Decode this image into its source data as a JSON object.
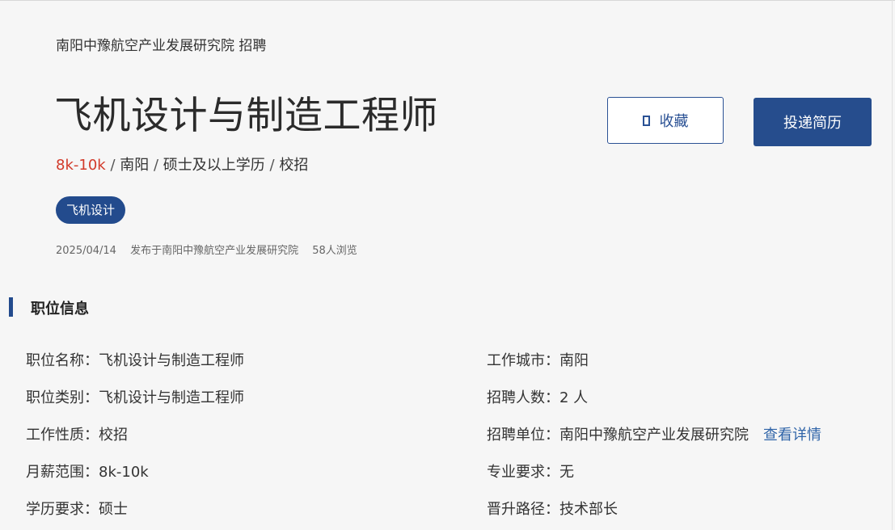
{
  "header": {
    "company_line": "南阳中豫航空产业发展研究院 招聘",
    "job_title": "飞机设计与制造工程师",
    "salary": "8k-10k",
    "separator": "/",
    "city": "南阳",
    "education": "硕士及以上学历",
    "type": "校招",
    "tag": "飞机设计",
    "post_date": "2025/04/14",
    "posted_by": "发布于南阳中豫航空产业发展研究院",
    "views": "58人浏览"
  },
  "actions": {
    "favorite_label": "收藏",
    "apply_label": "投递简历"
  },
  "section": {
    "title": "职位信息"
  },
  "info_left": [
    {
      "label": "职位名称：",
      "value": "飞机设计与制造工程师"
    },
    {
      "label": "职位类别：",
      "value": "飞机设计与制造工程师"
    },
    {
      "label": "工作性质：",
      "value": "校招"
    },
    {
      "label": "月薪范围：",
      "value": "8k-10k"
    },
    {
      "label": "学历要求：",
      "value": "硕士"
    }
  ],
  "info_right": [
    {
      "label": "工作城市：",
      "value": "南阳"
    },
    {
      "label": "招聘人数：",
      "value": "2 人"
    },
    {
      "label": "招聘单位：",
      "value": "南阳中豫航空产业发展研究院",
      "link": "查看详情"
    },
    {
      "label": "专业要求：",
      "value": "无"
    },
    {
      "label": "晋升路径：",
      "value": "技术部长"
    }
  ],
  "colors": {
    "primary": "#264d8d",
    "salary": "#d23a2a",
    "link": "#2f64a8",
    "background": "#f6f6f6"
  }
}
